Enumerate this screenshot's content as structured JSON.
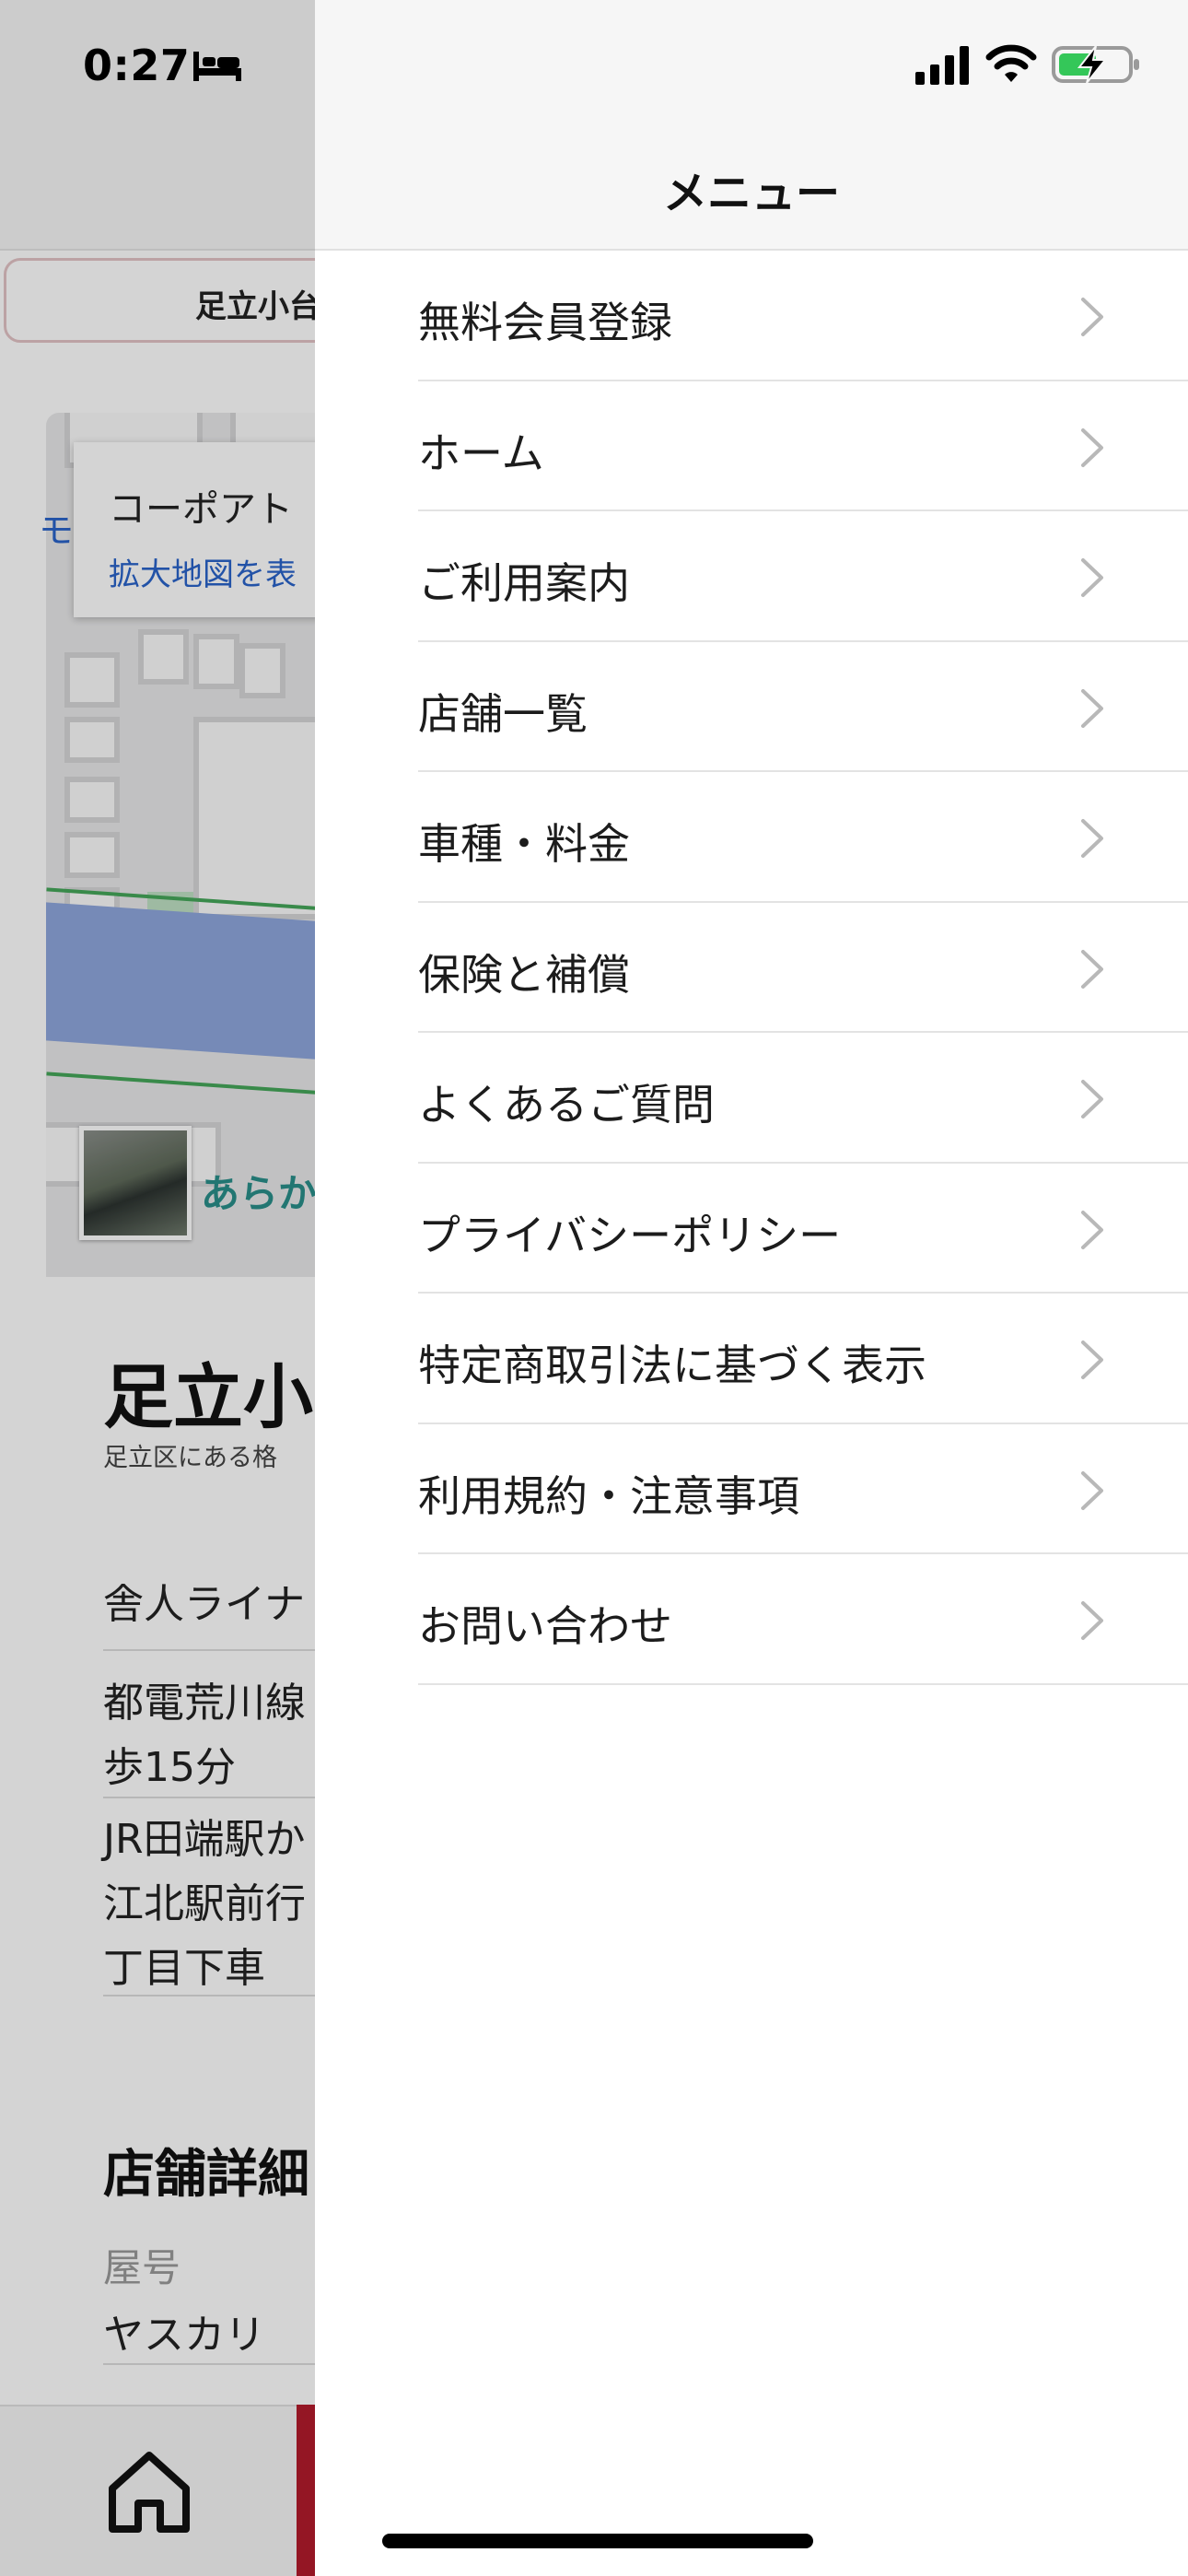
{
  "status_bar": {
    "time": "0:27"
  },
  "background_page": {
    "search_tab_label": "足立小台",
    "map_popup_title": "コーポアト",
    "map_popup_link": "拡大地図を表",
    "map_side_text": "モ",
    "map_thumb_label": "あらか",
    "store_title": "足立小",
    "store_subtitle": "足立区にある格",
    "access_lines": [
      "舎人ライナ",
      "都電荒川線",
      "歩15分",
      "JR田端駅か",
      "江北駅前行",
      "丁目下車"
    ],
    "details_heading": "店舗詳細",
    "detail_label": "屋号",
    "detail_value": "ヤスカリ"
  },
  "drawer": {
    "title": "メニュー",
    "items": [
      {
        "label": "無料会員登録"
      },
      {
        "label": "ホーム"
      },
      {
        "label": "ご利用案内"
      },
      {
        "label": "店舗一覧"
      },
      {
        "label": "車種・料金"
      },
      {
        "label": "保険と補償"
      },
      {
        "label": "よくあるご質問"
      },
      {
        "label": "プライバシーポリシー"
      },
      {
        "label": "特定商取引法に基づく表示"
      },
      {
        "label": "利用規約・注意事項"
      },
      {
        "label": "お問い合わせ"
      }
    ]
  },
  "icons": {
    "bed": "bed-icon",
    "signal": "cellular-signal-icon",
    "wifi": "wifi-icon",
    "battery": "battery-charging-icon",
    "chevron": "chevron-right-icon",
    "home": "home-icon"
  },
  "colors": {
    "accent": "#b31b2c",
    "link": "#2a63c9",
    "battery_fill": "#34c759"
  }
}
